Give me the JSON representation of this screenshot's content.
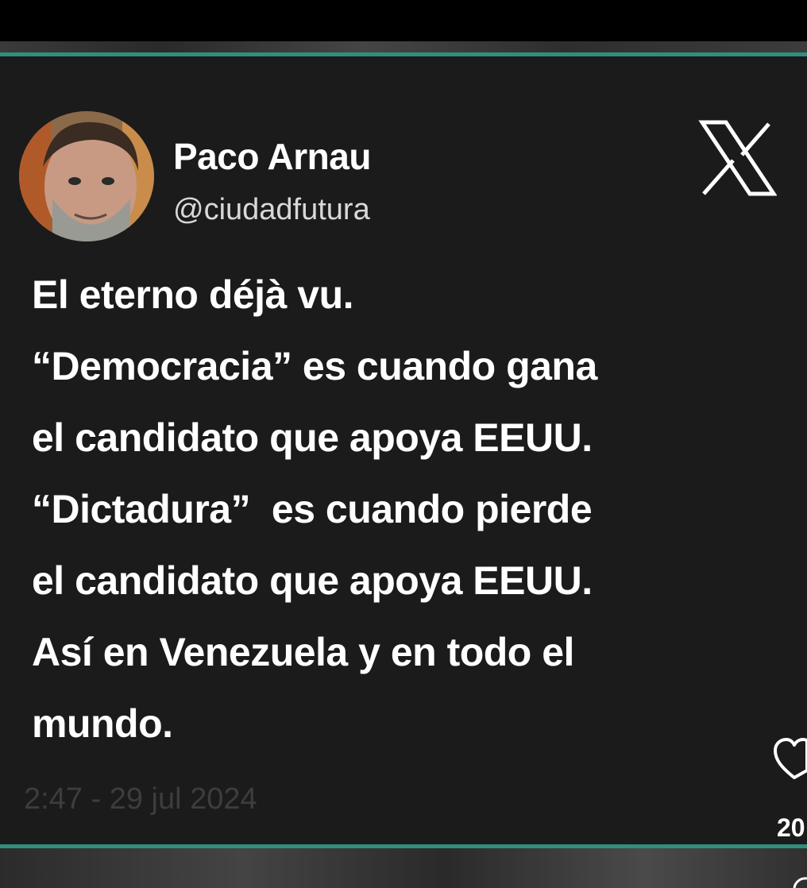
{
  "tweet": {
    "author_name": "Paco Arnau",
    "author_handle": "@ciudadfutura",
    "lines": [
      "El eterno déjà vu.",
      "“Democracia” es cuando gana",
      "el candidato que apoya EEUU.",
      "“Dictadura”  es cuando pierde",
      "el candidato que apoya EEUU.",
      "Así en Venezuela y en todo el",
      "mundo."
    ],
    "timestamp": "2:47 - 29 jul 2024"
  },
  "overlay": {
    "like_count": "20"
  },
  "icons": {
    "platform": "x-logo-icon",
    "like": "heart-icon"
  },
  "colors": {
    "card_background": "#1b1b1b",
    "accent": "#2f8f7c",
    "text": "#ffffff",
    "timestamp": "#3d3d3d"
  }
}
